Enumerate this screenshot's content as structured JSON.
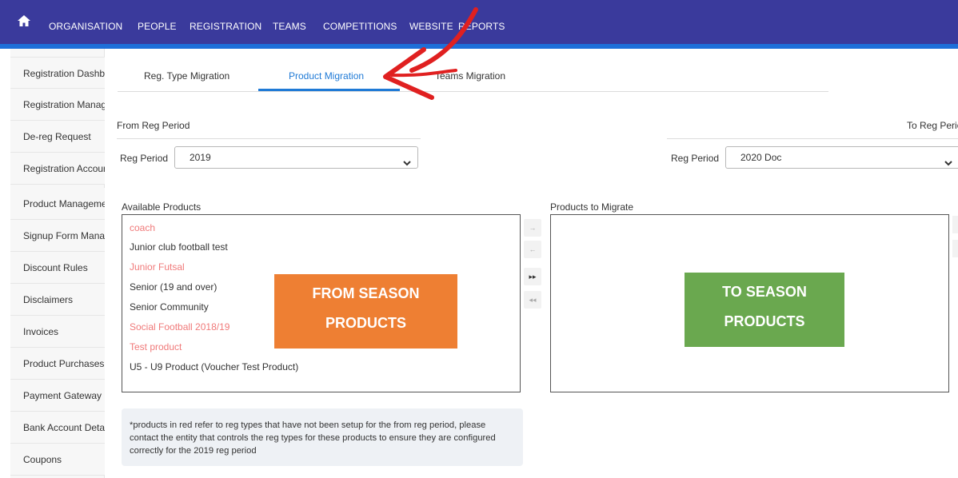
{
  "topnav": {
    "items": [
      "ORGANISATION",
      "PEOPLE",
      "REGISTRATION",
      "TEAMS",
      "COMPETITIONS",
      "WEBSITE",
      "REPORTS"
    ]
  },
  "sidebar": {
    "items": [
      {
        "label": "Registration Dashboard"
      },
      {
        "label": "Registration Management"
      },
      {
        "label": "De-reg Request"
      },
      {
        "label": "Registration Account"
      },
      {
        "label": "Product Management"
      },
      {
        "label": "Signup Form Management"
      },
      {
        "label": "Discount Rules"
      },
      {
        "label": "Disclaimers"
      },
      {
        "label": "Invoices"
      },
      {
        "label": "Product Purchases"
      },
      {
        "label": "Payment Gateway"
      },
      {
        "label": "Bank Account Details"
      },
      {
        "label": "Coupons"
      }
    ]
  },
  "tabs": [
    {
      "label": "Reg. Type Migration"
    },
    {
      "label": "Product Migration",
      "active": true
    },
    {
      "label": "Teams Migration"
    }
  ],
  "from": {
    "heading": "From Reg Period",
    "field_label": "Reg Period",
    "selected": "2019"
  },
  "to": {
    "heading": "To Reg Period",
    "field_label": "Reg Period",
    "selected": "2020 Doc"
  },
  "available": {
    "label": "Available Products",
    "items": [
      {
        "text": "coach",
        "missing_reg_type": true
      },
      {
        "text": "Junior club football test",
        "missing_reg_type": false
      },
      {
        "text": "Junior Futsal",
        "missing_reg_type": true
      },
      {
        "text": "Senior (19 and over)",
        "missing_reg_type": false
      },
      {
        "text": "Senior Community",
        "missing_reg_type": false
      },
      {
        "text": "Social Football 2018/19",
        "missing_reg_type": true
      },
      {
        "text": "Test product",
        "missing_reg_type": true
      },
      {
        "text": "U5 - U9 Product (Voucher Test Product)",
        "missing_reg_type": false
      }
    ]
  },
  "migrate": {
    "label": "Products to Migrate",
    "items": []
  },
  "move_buttons": {
    "right_single": "→",
    "left_single": "←",
    "right_all": "▸▸",
    "left_all": "◂◂"
  },
  "overlays": {
    "from_line1": "FROM SEASON",
    "from_line2": "PRODUCTS",
    "to_line1": "TO SEASON",
    "to_line2": "PRODUCTS"
  },
  "note": "*products in red refer to reg types that have not been setup for the from reg period, please contact the entity that controls the reg types for these products to ensure they are configured correctly for the 2019 reg period",
  "colors": {
    "nav_bg": "#3a3a9c",
    "accent": "#1f7ad6",
    "missing_red": "#f07a7a",
    "orange": "#ee7f33",
    "green": "#6aa84f",
    "arrow_red": "#e02020"
  }
}
